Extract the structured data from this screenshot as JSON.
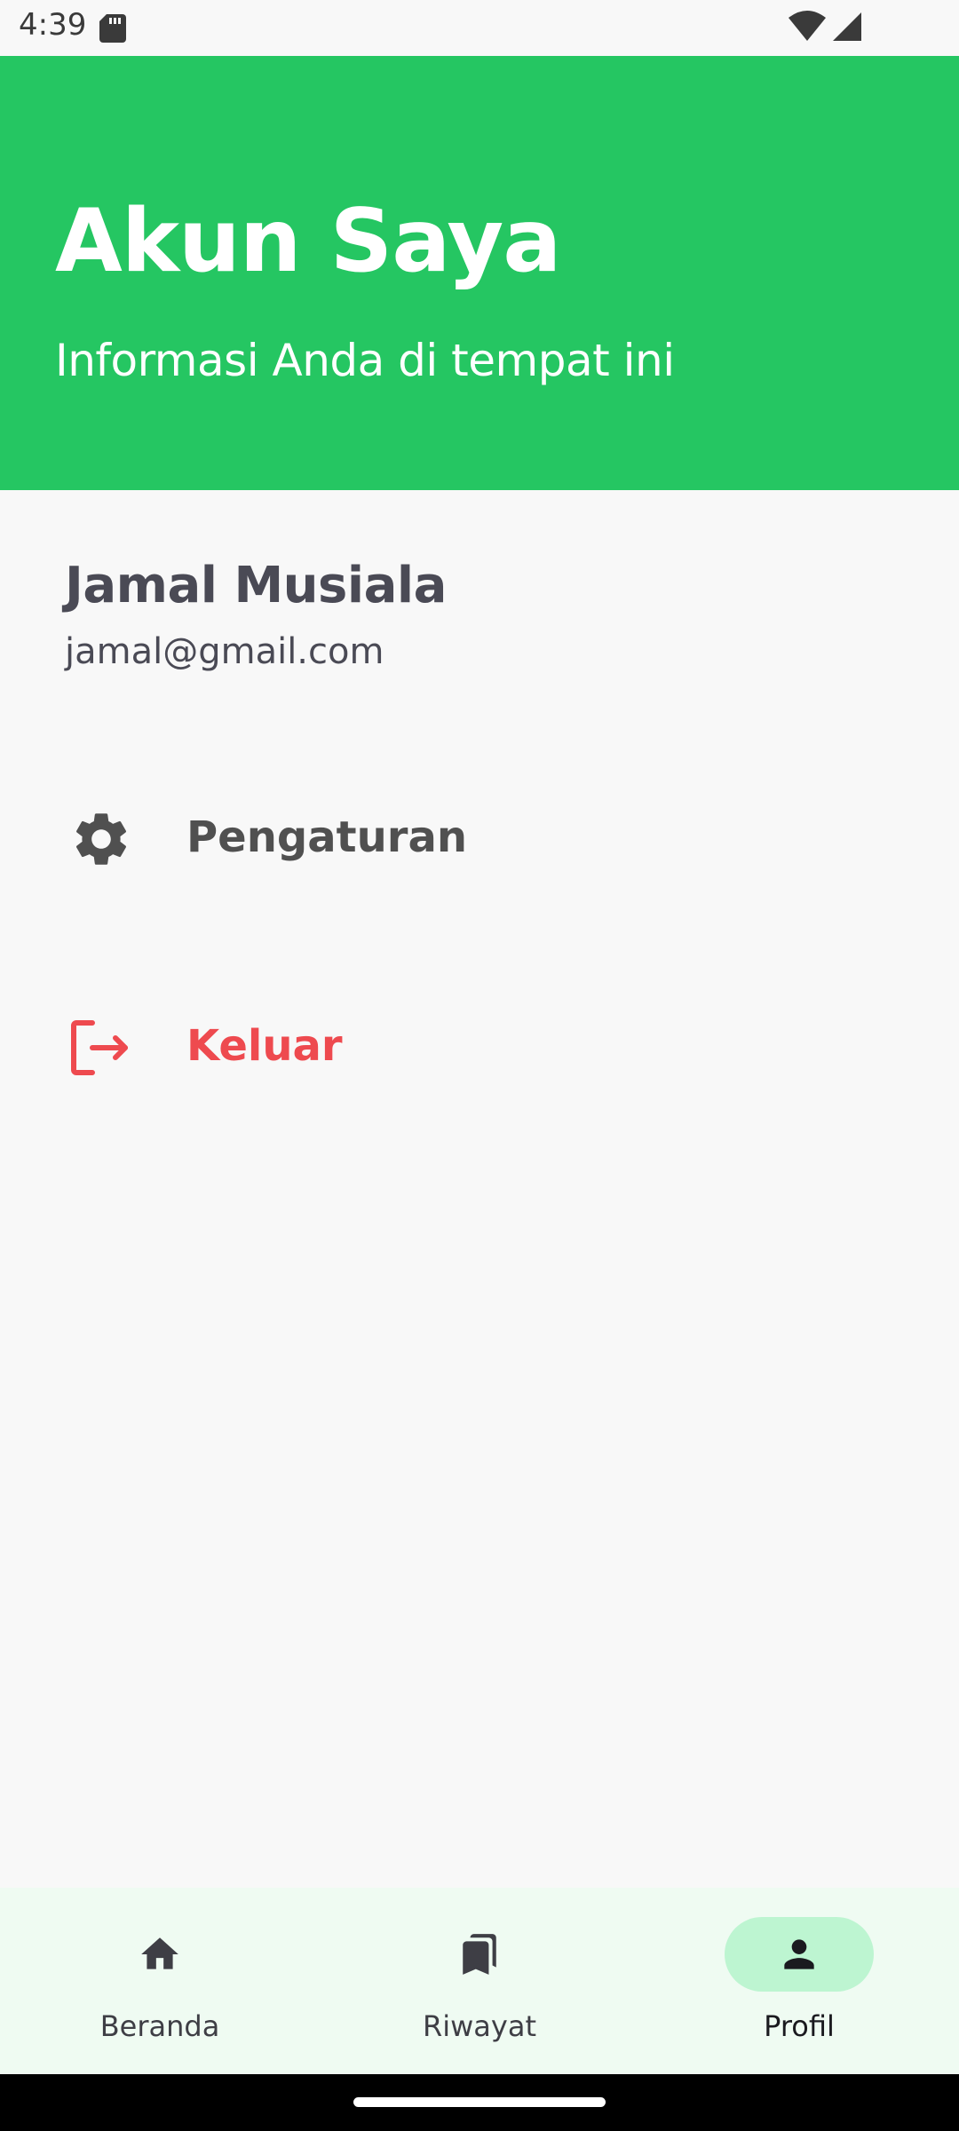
{
  "status_bar": {
    "time": "4:39",
    "icons": [
      "sd-card-icon",
      "wifi-icon",
      "signal-icon"
    ]
  },
  "header": {
    "title": "Akun Saya",
    "subtitle": "Informasi Anda di tempat ini",
    "background_color": "#25C662"
  },
  "profile": {
    "name": "Jamal Musiala",
    "email": "jamal@gmail.com"
  },
  "menu": {
    "settings": {
      "label": "Pengaturan",
      "icon": "gear-icon"
    },
    "logout": {
      "label": "Keluar",
      "icon": "logout-icon",
      "color": "#EE4A4F"
    }
  },
  "bottom_nav": {
    "items": [
      {
        "label": "Beranda",
        "icon": "home-icon",
        "selected": false
      },
      {
        "label": "Riwayat",
        "icon": "bookmarks-icon",
        "selected": false
      },
      {
        "label": "Profil",
        "icon": "person-icon",
        "selected": true
      }
    ],
    "selected_pill_color": "#BDF5D1"
  }
}
